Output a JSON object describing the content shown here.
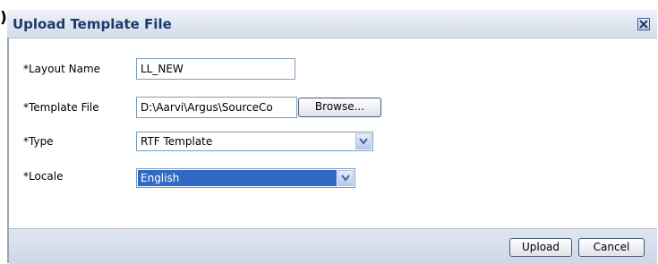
{
  "dialog": {
    "title": "Upload Template File",
    "close_icon": "close-icon"
  },
  "form": {
    "layout_name": {
      "label": "*Layout Name",
      "value": "LL_NEW"
    },
    "template_file": {
      "label": "*Template File",
      "value": "D:\\Aarvi\\Argus\\SourceCo",
      "browse_label": "Browse..."
    },
    "type": {
      "label": "*Type",
      "value": "RTF Template"
    },
    "locale": {
      "label": "*Locale",
      "value": "English"
    }
  },
  "footer": {
    "upload_label": "Upload",
    "cancel_label": "Cancel"
  },
  "colors": {
    "title_text": "#1c3a6b",
    "selection": "#316ac5"
  }
}
